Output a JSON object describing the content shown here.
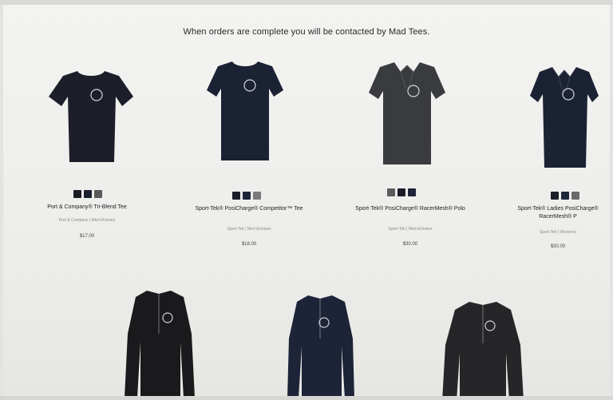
{
  "header": {
    "message": "When orders are complete you will be contacted by Mad Tees."
  },
  "products": [
    {
      "name": "Port & Company® Tri-Blend Tee",
      "meta": "Port & Company | Men's/Unisex",
      "price": "$17.00",
      "swatch_colors": [
        "#1a1c24",
        "#1b2030",
        "#5a5a5a"
      ],
      "garment_color": "#1c1f2a",
      "icon": "tshirt-icon"
    },
    {
      "name": "Sport-Tek® PosiCharge® Competitor™ Tee",
      "meta": "Sport-Tek | Men's/Unisex",
      "price": "$18.00",
      "swatch_colors": [
        "#1b1e29",
        "#1d2538",
        "#7a7a7a"
      ],
      "garment_color": "#1b2233",
      "icon": "tshirt-icon"
    },
    {
      "name": "Sport-Tek® PosiCharge® RacerMesh® Polo",
      "meta": "Sport-Tek | Men's/Unisex",
      "price": "$30.00",
      "swatch_colors": [
        "#5c5c5c",
        "#1a1d28",
        "#1d2437"
      ],
      "garment_color": "#3a3b3f",
      "icon": "polo-icon"
    },
    {
      "name": "Sport-Tek® Ladies PosiCharge® RacerMesh® P",
      "meta": "Sport-Tek | Women's",
      "price": "$30.00",
      "swatch_colors": [
        "#1b1e29",
        "#1d2538",
        "#6a6a6a"
      ],
      "garment_color": "#1b2233",
      "icon": "polo-icon"
    }
  ],
  "jackets": [
    {
      "garment_color": "#1a1a1c",
      "icon": "quarter-zip-icon"
    },
    {
      "garment_color": "#1d2438",
      "icon": "quarter-zip-icon"
    },
    {
      "garment_color": "#262628",
      "icon": "quarter-zip-icon"
    }
  ]
}
